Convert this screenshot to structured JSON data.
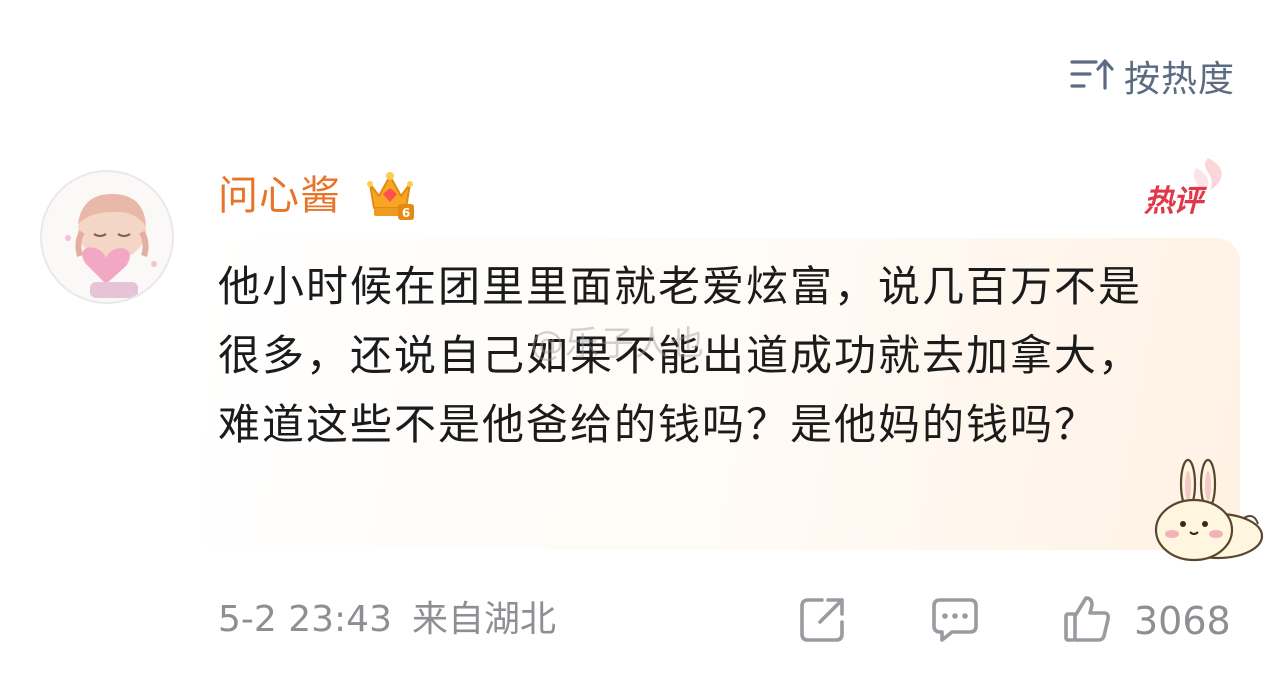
{
  "sort": {
    "label": "按热度",
    "icon": "sort-icon"
  },
  "comment": {
    "username": "问心酱",
    "user_badge": "vip-crown-badge",
    "hot_tag": "热评",
    "text": "他小时候在团里里面就老爱炫富，说几百万不是很多，还说自己如果不能出道成功就去加拿大，难道这些不是他爸给的钱吗？是他妈的钱吗？",
    "watermark": "@乐子人也",
    "timestamp": "5-2 23:43",
    "location": "来自湖北",
    "like_count": "3068"
  },
  "colors": {
    "username": "#e8742a",
    "hot_tag": "#e0384a",
    "meta_text": "#8e8e93",
    "sort_text": "#5b6b82"
  }
}
